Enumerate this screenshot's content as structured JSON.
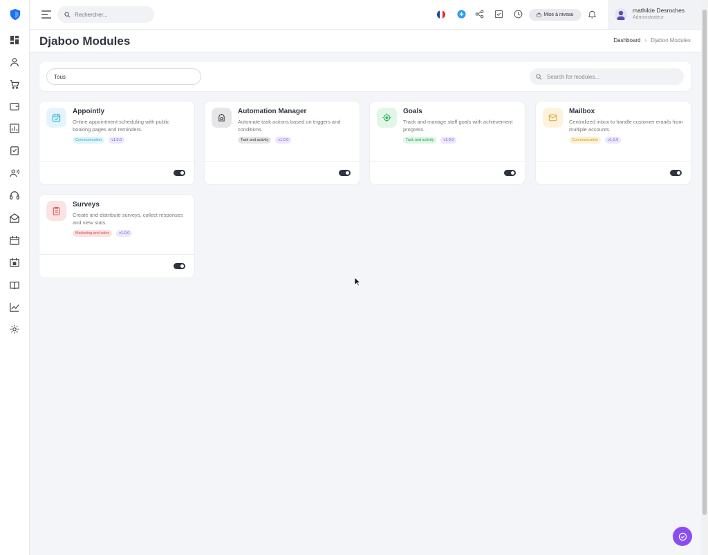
{
  "topbar": {
    "search_placeholder": "Rechercher...",
    "upgrade_label": "Mise à niveau",
    "icons": [
      "flag-fr-icon",
      "add-circle-icon",
      "share-icon",
      "task-check-icon",
      "clock-icon",
      "bell-icon"
    ]
  },
  "user": {
    "name": "mathilde Desroches",
    "role": "Administrateur"
  },
  "sidebar": {
    "icons": [
      "dashboard-icon",
      "user-icon",
      "cart-icon",
      "wallet-icon",
      "chart-icon",
      "clipboard-icon",
      "users-sound-icon",
      "headset-icon",
      "mail-open-icon",
      "calendar-icon",
      "calendar-check-icon",
      "book-icon",
      "line-chart-icon",
      "settings-icon"
    ]
  },
  "page": {
    "title": "Djaboo Modules",
    "breadcrumb": [
      "Dashboard",
      "Djaboo Modules"
    ]
  },
  "filters": {
    "category_value": "Tous",
    "search_placeholder": "Search for modules..."
  },
  "modules": [
    {
      "title": "Appointly",
      "description": "Online appointment scheduling with public booking pages and reminders.",
      "tag": "Communication",
      "version": "v1.0.0",
      "icon": "calendar-check-icon",
      "enabled": true
    },
    {
      "title": "Automation Manager",
      "description": "Automate task actions based on triggers and conditions.",
      "tag": "Task and activity",
      "version": "v1.0.0",
      "icon": "robot-icon",
      "enabled": true
    },
    {
      "title": "Goals",
      "description": "Track and manage staff goals with achievement progress.",
      "tag": "Task and activity",
      "version": "v1.0.0",
      "icon": "target-icon",
      "enabled": true
    },
    {
      "title": "Mailbox",
      "description": "Centralized inbox to handle customer emails from multiple accounts.",
      "tag": "Communication",
      "version": "v1.0.0",
      "icon": "mail-icon",
      "enabled": true
    },
    {
      "title": "Surveys",
      "description": "Create and distribute surveys, collect responses and view stats.",
      "tag": "Marketing and sales",
      "version": "v1.0.0",
      "icon": "survey-icon",
      "enabled": true
    }
  ],
  "colors": {
    "accent": "#8a4ef0",
    "brand": "#1e6ff5",
    "toggle_on": "#2f3440"
  }
}
